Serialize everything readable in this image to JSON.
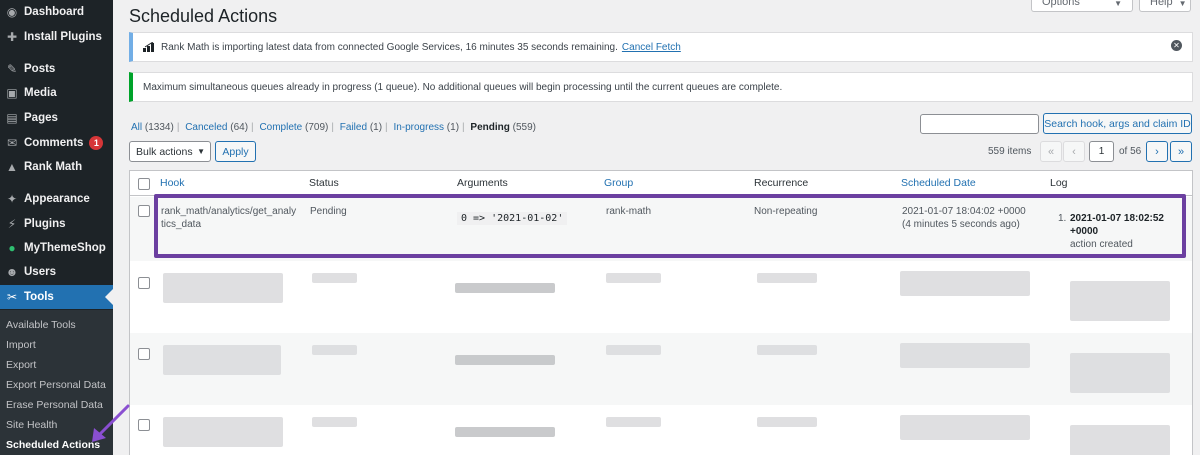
{
  "sidebar": {
    "items": [
      {
        "label": "Dashboard",
        "icon": "dashboard-icon",
        "glyph": "◉"
      },
      {
        "label": "Install Plugins",
        "icon": "plugins-install-icon",
        "glyph": "✚"
      },
      {
        "label": "Posts",
        "icon": "pin-icon",
        "glyph": "✎"
      },
      {
        "label": "Media",
        "icon": "media-icon",
        "glyph": "▣"
      },
      {
        "label": "Pages",
        "icon": "pages-icon",
        "glyph": "▤"
      },
      {
        "label": "Comments",
        "icon": "comments-icon",
        "glyph": "✉",
        "badge": "1"
      },
      {
        "label": "Rank Math",
        "icon": "rank-math-icon",
        "glyph": "▲"
      },
      {
        "label": "Appearance",
        "icon": "appearance-icon",
        "glyph": "✦"
      },
      {
        "label": "Plugins",
        "icon": "plugins-icon",
        "glyph": "⚡"
      },
      {
        "label": "MyThemeShop",
        "icon": "mythemeshop-icon",
        "glyph": "●"
      },
      {
        "label": "Users",
        "icon": "users-icon",
        "glyph": "☻"
      },
      {
        "label": "Tools",
        "icon": "tools-icon",
        "glyph": "✂"
      }
    ],
    "submenu": [
      "Available Tools",
      "Import",
      "Export",
      "Export Personal Data",
      "Erase Personal Data",
      "Site Health",
      "Scheduled Actions"
    ]
  },
  "header": {
    "title": "Scheduled Actions",
    "screen_options": "Screen Options",
    "help": "Help"
  },
  "notices": {
    "import": "Rank Math is importing latest data from connected Google Services, 16 minutes 35 seconds remaining.",
    "cancel_link": "Cancel Fetch",
    "queue": "Maximum simultaneous queues already in progress (1 queue). No additional queues will begin processing until the current queues are complete."
  },
  "filters": {
    "all": "All",
    "all_count": "(1334)",
    "canceled": "Canceled",
    "canceled_count": "(64)",
    "complete": "Complete",
    "complete_count": "(709)",
    "failed": "Failed",
    "failed_count": "(1)",
    "in_progress": "In-progress",
    "in_progress_count": "(1)",
    "pending": "Pending",
    "pending_count": "(559)",
    "separator": "|"
  },
  "search": {
    "button": "Search hook, args and claim ID",
    "value": ""
  },
  "bulk": {
    "selected": "Bulk actions",
    "apply": "Apply"
  },
  "pagination": {
    "items": "559 items",
    "first": "«",
    "prev": "‹",
    "current": "1",
    "of": "of 56",
    "next": "›",
    "last": "»"
  },
  "table": {
    "headers": {
      "hook": "Hook",
      "status": "Status",
      "arguments": "Arguments",
      "group": "Group",
      "recurrence": "Recurrence",
      "scheduled": "Scheduled Date",
      "log": "Log"
    },
    "row": {
      "hook_line1": "rank_math/analytics/get_analy",
      "hook_line2": "tics_data",
      "status": "Pending",
      "arguments": "0 => '2021-01-02'",
      "group": "rank-math",
      "recurrence": "Non-repeating",
      "scheduled_line1": "2021-01-07 18:04:02 +0000",
      "scheduled_line2": "(4 minutes 5 seconds ago)",
      "log_num": "1.",
      "log_date1": "2021-01-07 18:02:52",
      "log_date2": "+0000",
      "log_text": "action created"
    }
  },
  "colors": {
    "accent": "#2271b1",
    "sidebar": "#1d2327",
    "highlight": "#6b3fa0"
  }
}
